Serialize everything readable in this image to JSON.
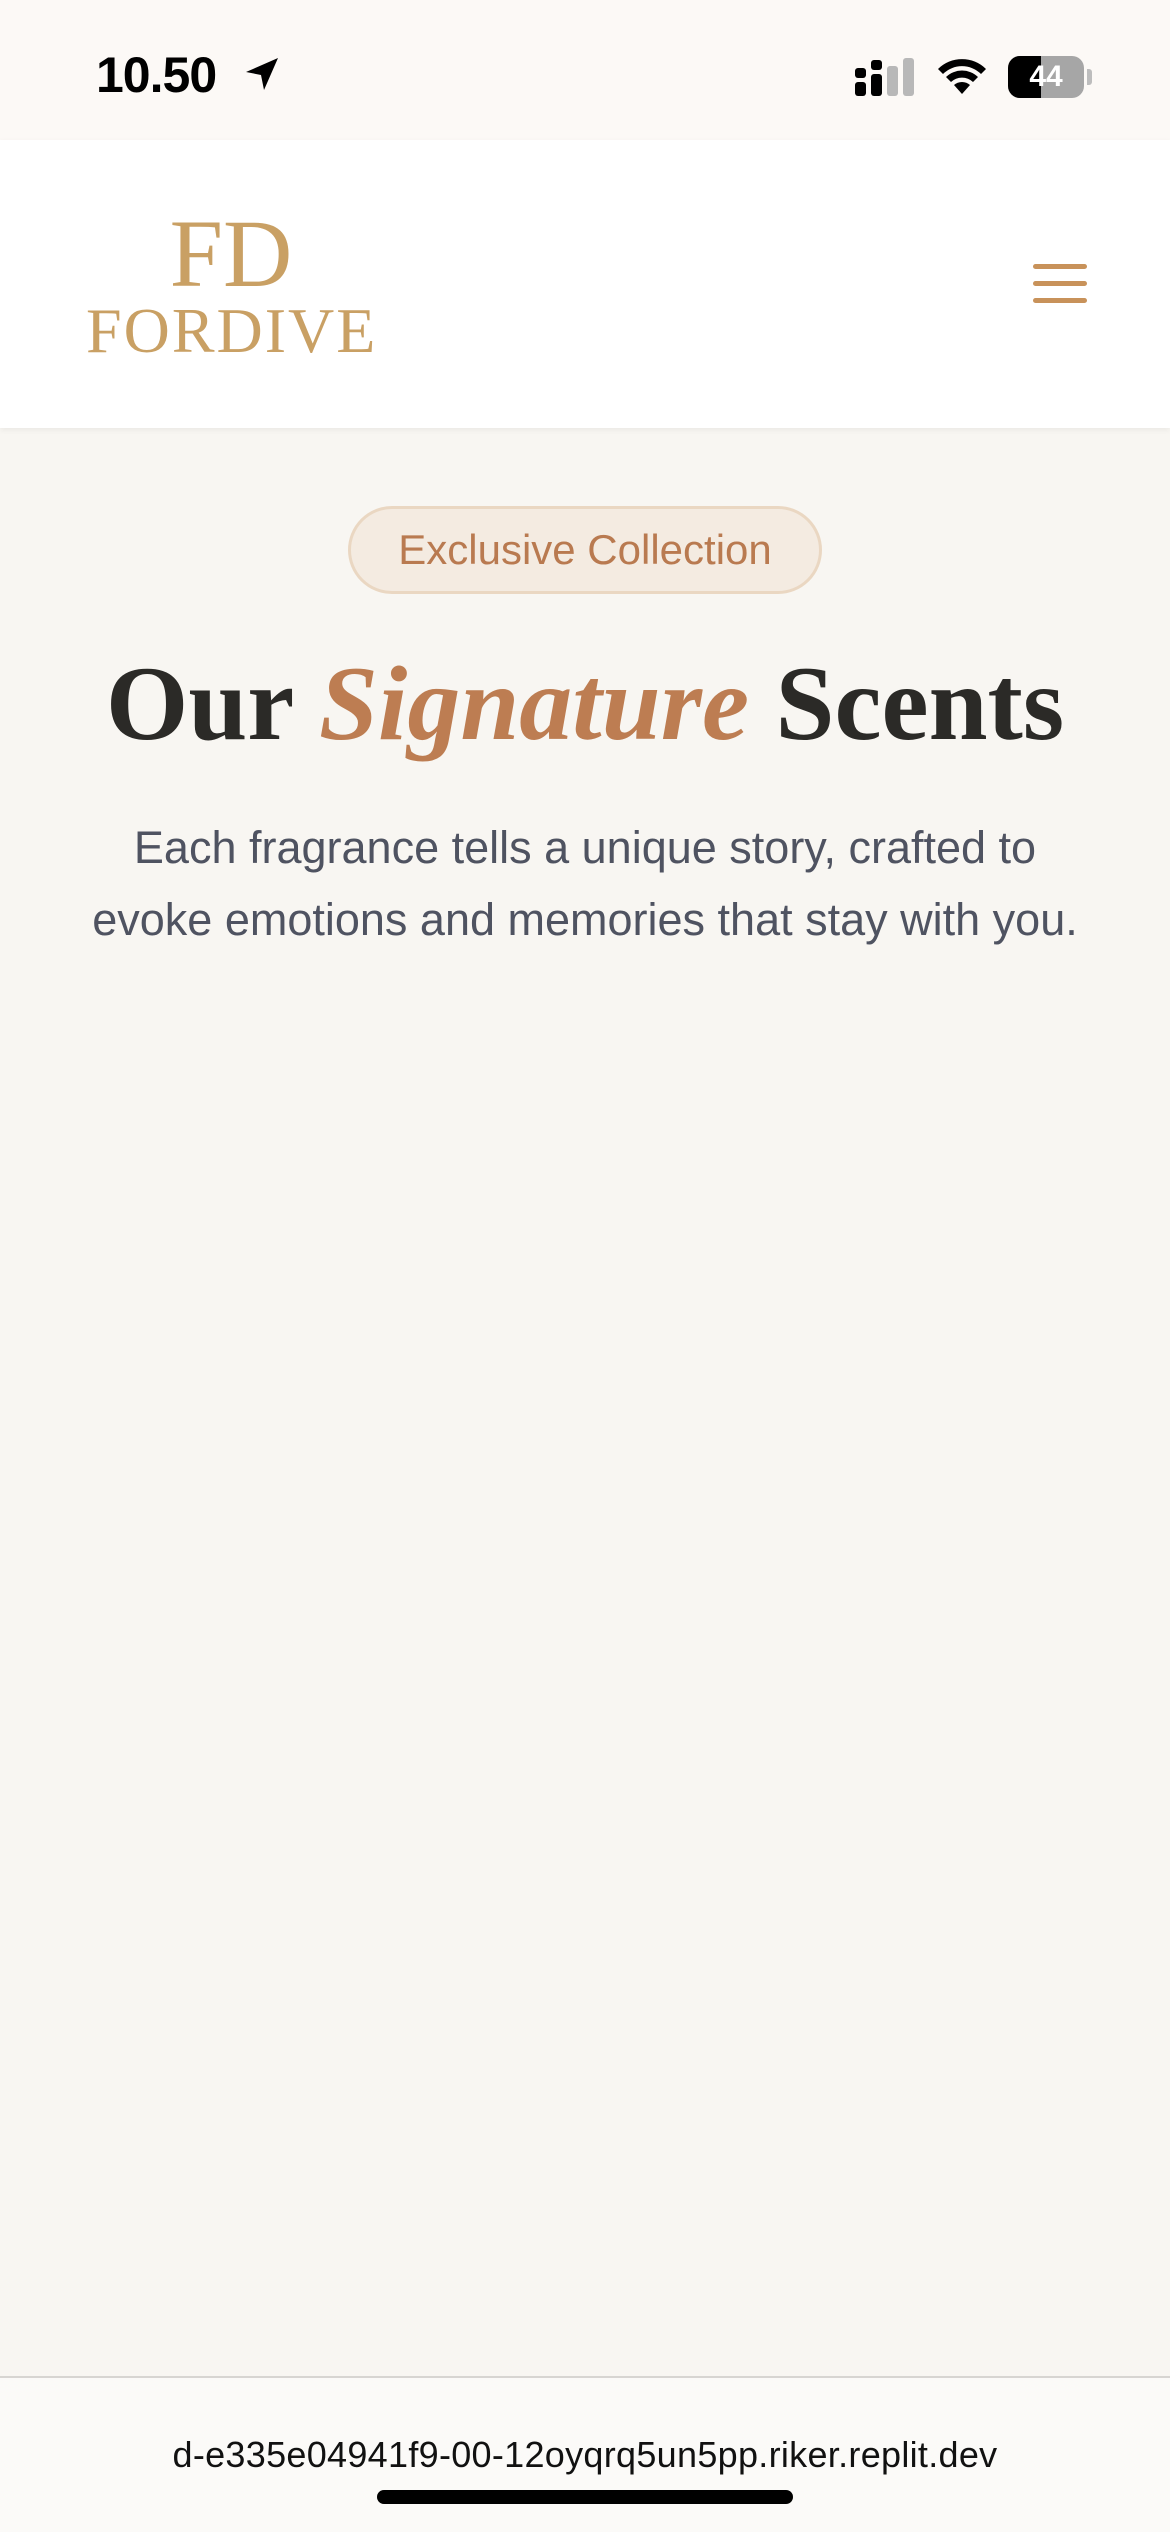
{
  "status_bar": {
    "time": "10.50",
    "battery_level": "44",
    "battery_fraction": 0.44
  },
  "header": {
    "logo_mark": "FD",
    "logo_text": "FORDIVE",
    "menu_icon": "hamburger-menu-icon"
  },
  "main": {
    "badge": "Exclusive Collection",
    "title_part1": "Our",
    "title_accent": "Signature",
    "title_part2": "Scents",
    "subtitle": "Each fragrance tells a unique story, crafted to evoke emotions and memories that stay with you."
  },
  "browser": {
    "url": "d-e335e04941f9-00-12oyqrq5un5pp.riker.replit.dev"
  },
  "colors": {
    "brand_gold": "#c9a064",
    "accent": "#bd7d52",
    "background": "#f8f6f2"
  }
}
